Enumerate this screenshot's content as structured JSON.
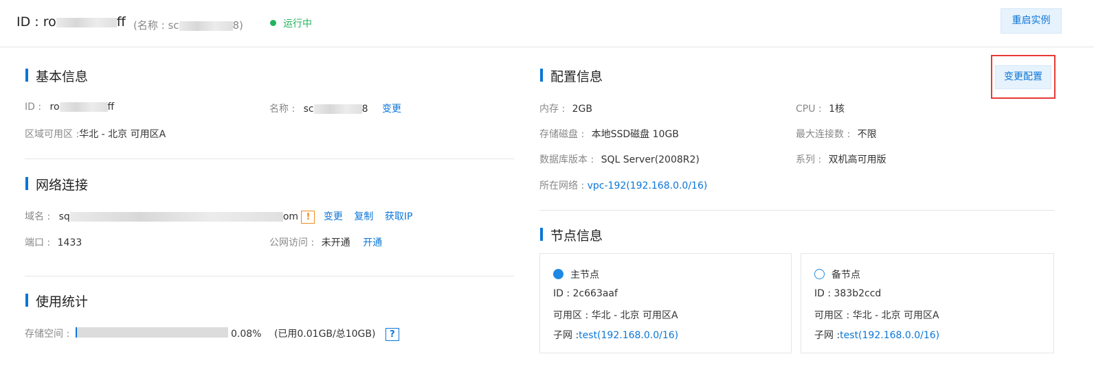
{
  "header": {
    "id_prefix": "ID : ro",
    "id_suffix": "ff",
    "name_prefix": "(名称 : sc",
    "name_suffix": "8)",
    "status": "运行中",
    "restart_button": "重启实例"
  },
  "basic": {
    "title": "基本信息",
    "id_label": "ID :",
    "id_prefix": "ro",
    "id_suffix": "ff",
    "name_label": "名称 :",
    "name_prefix": "sc",
    "name_suffix": "8",
    "name_change": "变更",
    "zone_label": "区域可用区 :",
    "zone_value": "华北 - 北京 可用区A"
  },
  "network": {
    "title": "网络连接",
    "domain_label": "域名 :",
    "domain_prefix": "sq",
    "domain_suffix": "om",
    "warn_glyph": "!",
    "change": "变更",
    "copy": "复制",
    "get_ip": "获取IP",
    "port_label": "端口 :",
    "port_value": "1433",
    "public_label": "公网访问 :",
    "public_value": "未开通",
    "open": "开通"
  },
  "usage": {
    "title": "使用统计",
    "storage_label": "存储空间 :",
    "percent_text": "0.08%",
    "percent": 0.0008,
    "detail": "(已用0.01GB/总10GB)",
    "help_glyph": "?"
  },
  "config": {
    "title": "配置信息",
    "change_button": "变更配置",
    "memory_label": "内存 :",
    "memory_value": "2GB",
    "cpu_label": "CPU :",
    "cpu_value": "1核",
    "disk_label": "存储磁盘 :",
    "disk_value": "本地SSD磁盘 10GB",
    "maxconn_label": "最大连接数 :",
    "maxconn_value": "不限",
    "dbver_label": "数据库版本 :",
    "dbver_value": "SQL Server(2008R2)",
    "series_label": "系列 :",
    "series_value": "双机高可用版",
    "net_label": "所在网络 :",
    "net_value": "vpc-192(192.168.0.0/16)"
  },
  "nodes": {
    "title": "节点信息",
    "primary": {
      "label": "主节点",
      "id": "ID : 2c663aaf",
      "zone": "可用区 : 华北 - 北京 可用区A",
      "subnet_label": "子网 :",
      "subnet_value": "test(192.168.0.0/16)"
    },
    "standby": {
      "label": "备节点",
      "id": "ID : 383b2ccd",
      "zone": "可用区 : 华北 - 北京 可用区A",
      "subnet_label": "子网 :",
      "subnet_value": "test(192.168.0.0/16)"
    }
  },
  "colors": {
    "accent": "#0a76d8",
    "status_green": "#22b35e",
    "warn_orange": "#f08a1c",
    "highlight_red": "#e53935"
  }
}
